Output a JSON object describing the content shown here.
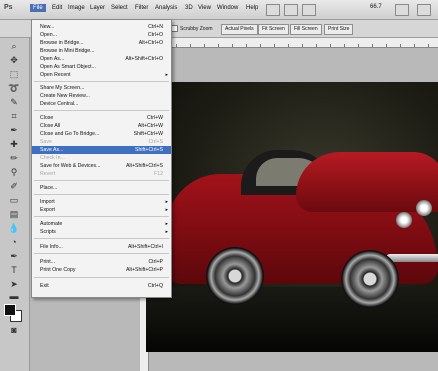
{
  "menubar": {
    "logo": "Ps",
    "items": [
      "File",
      "Edit",
      "Image",
      "Layer",
      "Select",
      "Filter",
      "Analysis",
      "3D",
      "View",
      "Window",
      "Help"
    ],
    "zoom": "66.7"
  },
  "options_bar": {
    "scrubby_zoom": "Scrubby Zoom",
    "actual_pixels": "Actual Pixels",
    "fit_screen": "Fit Screen",
    "fill_screen": "Fill Screen",
    "print_size": "Print Size"
  },
  "file_menu": {
    "items": [
      {
        "label": "New...",
        "shortcut": "Ctrl+N"
      },
      {
        "label": "Open...",
        "shortcut": "Ctrl+O"
      },
      {
        "label": "Browse in Bridge...",
        "shortcut": "Alt+Ctrl+O"
      },
      {
        "label": "Browse in Mini Bridge...",
        "shortcut": ""
      },
      {
        "label": "Open As...",
        "shortcut": "Alt+Shift+Ctrl+O"
      },
      {
        "label": "Open As Smart Object...",
        "shortcut": ""
      },
      {
        "label": "Open Recent",
        "shortcut": ""
      },
      {
        "label": "Share My Screen...",
        "shortcut": ""
      },
      {
        "label": "Create New Review...",
        "shortcut": ""
      },
      {
        "label": "Device Central...",
        "shortcut": ""
      },
      {
        "label": "Close",
        "shortcut": "Ctrl+W"
      },
      {
        "label": "Close All",
        "shortcut": "Alt+Ctrl+W"
      },
      {
        "label": "Close and Go To Bridge...",
        "shortcut": "Shift+Ctrl+W"
      },
      {
        "label": "Save",
        "shortcut": "Ctrl+S"
      },
      {
        "label": "Save As...",
        "shortcut": "Shift+Ctrl+S"
      },
      {
        "label": "Check In...",
        "shortcut": ""
      },
      {
        "label": "Save for Web & Devices...",
        "shortcut": "Alt+Shift+Ctrl+S"
      },
      {
        "label": "Revert",
        "shortcut": "F12"
      },
      {
        "label": "Place...",
        "shortcut": ""
      },
      {
        "label": "Import",
        "shortcut": ""
      },
      {
        "label": "Export",
        "shortcut": ""
      },
      {
        "label": "Automate",
        "shortcut": ""
      },
      {
        "label": "Scripts",
        "shortcut": ""
      },
      {
        "label": "File Info...",
        "shortcut": "Alt+Shift+Ctrl+I"
      },
      {
        "label": "Print...",
        "shortcut": "Ctrl+P"
      },
      {
        "label": "Print One Copy",
        "shortcut": "Alt+Shift+Ctrl+P"
      },
      {
        "label": "Exit",
        "shortcut": "Ctrl+Q"
      }
    ]
  },
  "colors": {
    "highlight": "#3f6fc0",
    "car_red": "#a3121a"
  }
}
